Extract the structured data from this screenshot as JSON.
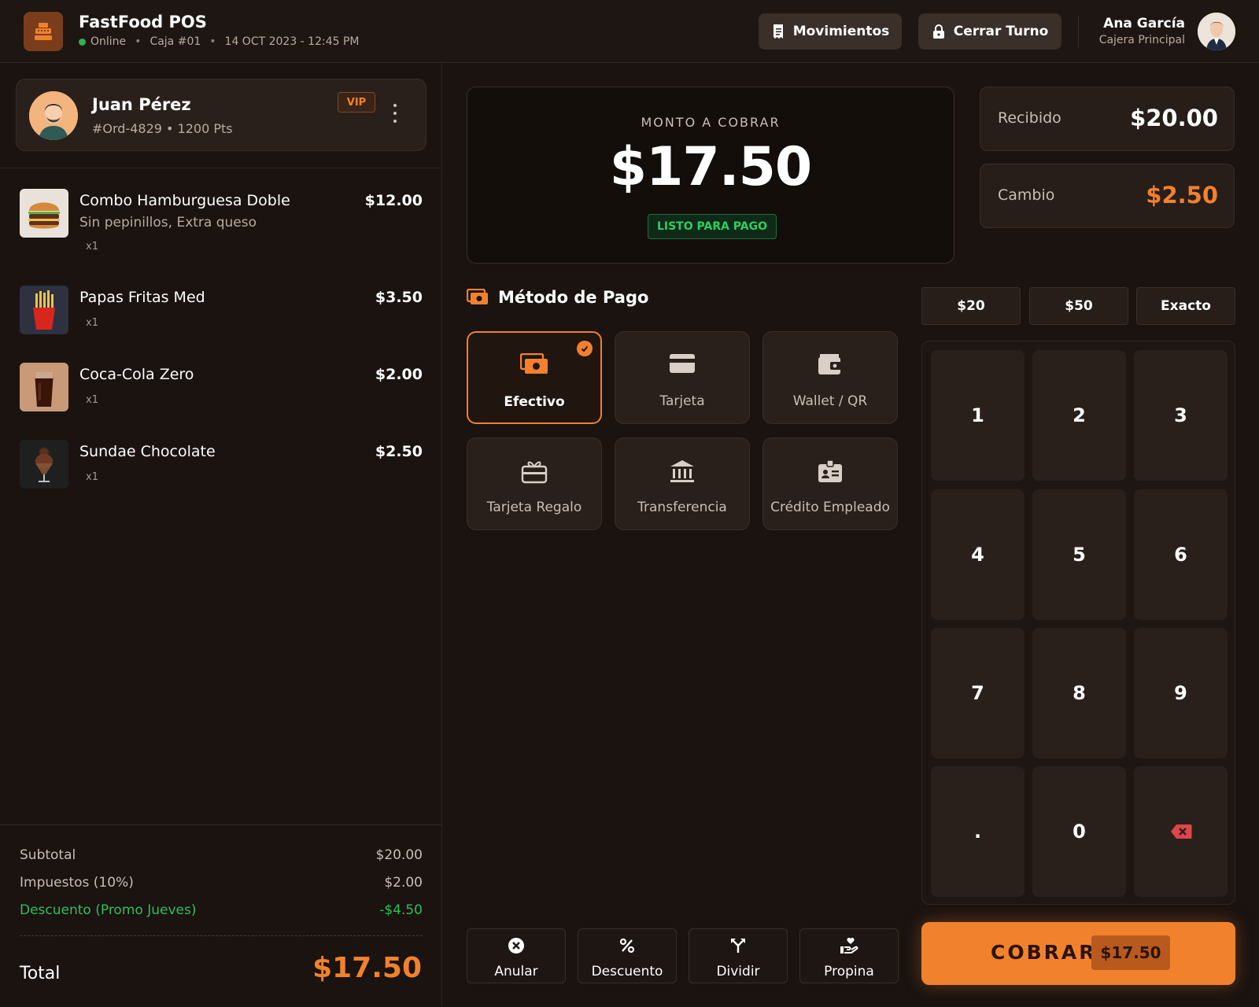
{
  "header": {
    "app_title": "FastFood POS",
    "status": "Online",
    "register": "Caja #01",
    "datetime": "14 OCT 2023 - 12:45 PM",
    "movements_label": "Movimientos",
    "close_shift_label": "Cerrar Turno",
    "user_name": "Ana García",
    "user_role": "Cajera Principal"
  },
  "customer": {
    "name": "Juan Pérez",
    "meta": "#Ord-4829 • 1200 Pts",
    "badge": "VIP"
  },
  "order_items": [
    {
      "name": "Combo Hamburguesa Doble",
      "note": "Sin pepinillos, Extra queso",
      "qty": "x1",
      "price": "$12.00"
    },
    {
      "name": "Papas Fritas Med",
      "note": "",
      "qty": "x1",
      "price": "$3.50"
    },
    {
      "name": "Coca-Cola Zero",
      "note": "",
      "qty": "x1",
      "price": "$2.00"
    },
    {
      "name": "Sundae Chocolate",
      "note": "",
      "qty": "x1",
      "price": "$2.50"
    }
  ],
  "totals": {
    "subtotal_label": "Subtotal",
    "subtotal": "$20.00",
    "tax_label": "Impuestos (10%)",
    "tax": "$2.00",
    "discount_label": "Descuento (Promo Jueves)",
    "discount": "-$4.50",
    "total_label": "Total",
    "total": "$17.50"
  },
  "amount": {
    "label": "MONTO A COBRAR",
    "value": "$17.50",
    "status": "LISTO PARA PAGO"
  },
  "received": {
    "label": "Recibido",
    "value": "$20.00"
  },
  "change": {
    "label": "Cambio",
    "value": "$2.50"
  },
  "payment": {
    "title": "Método de Pago",
    "methods": [
      {
        "label": "Efectivo",
        "icon": "cash-icon",
        "selected": true
      },
      {
        "label": "Tarjeta",
        "icon": "card-icon",
        "selected": false
      },
      {
        "label": "Wallet / QR",
        "icon": "wallet-icon",
        "selected": false
      },
      {
        "label": "Tarjeta Regalo",
        "icon": "gift-card-icon",
        "selected": false
      },
      {
        "label": "Transferencia",
        "icon": "bank-icon",
        "selected": false
      },
      {
        "label": "Crédito Empleado",
        "icon": "employee-badge-icon",
        "selected": false
      }
    ]
  },
  "quick_amounts": [
    "$20",
    "$50",
    "Exacto"
  ],
  "keypad": [
    "1",
    "2",
    "3",
    "4",
    "5",
    "6",
    "7",
    "8",
    "9",
    ".",
    "0"
  ],
  "actions": {
    "void": "Anular",
    "discount": "Descuento",
    "split": "Dividir",
    "tip": "Propina"
  },
  "charge": {
    "label": "COBRAR",
    "amount": "$17.50"
  },
  "colors": {
    "accent": "#f2812d",
    "success": "#2fbf5a",
    "background": "#1a1310",
    "danger": "#e0454a"
  }
}
